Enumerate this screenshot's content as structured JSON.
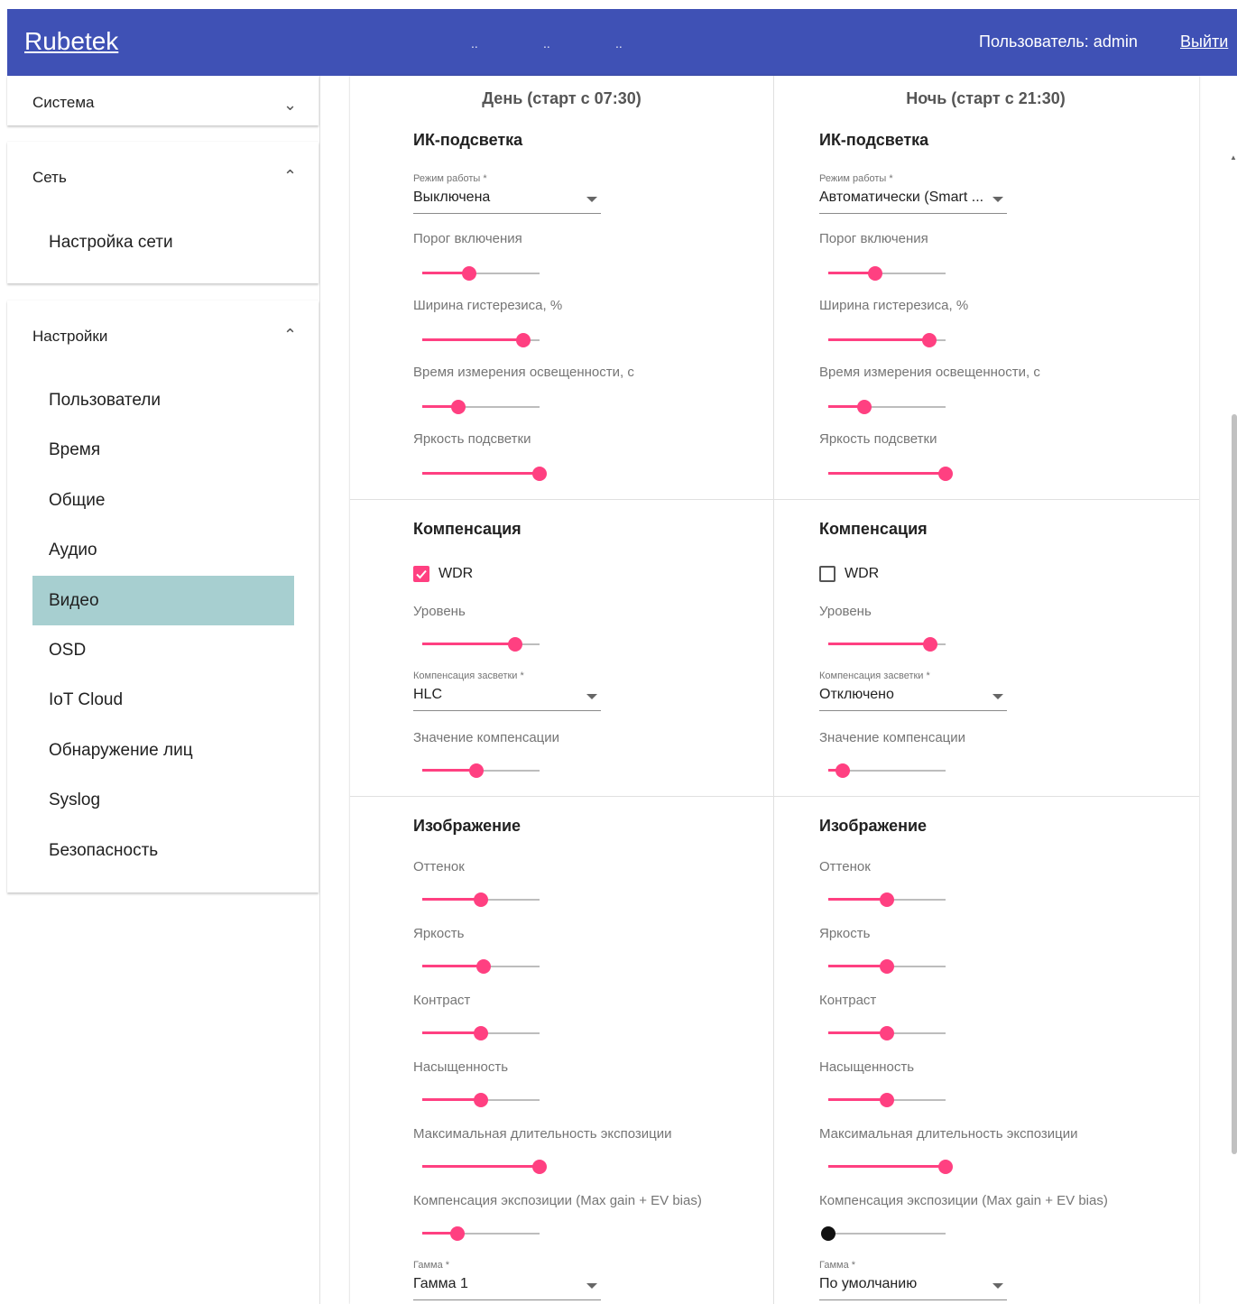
{
  "header": {
    "logo": "Rubetek",
    "dots": [
      "..",
      "..",
      ".."
    ],
    "user": "Пользователь: admin",
    "logout": "Выйти",
    "color": "#3f51b5"
  },
  "sidebar": {
    "system": {
      "label": "Система",
      "icon": "chevron-down-icon"
    },
    "network": {
      "label": "Сеть",
      "icon": "chevron-up-icon",
      "items": [
        "Настройка сети"
      ]
    },
    "settings": {
      "label": "Настройки",
      "icon": "chevron-up-icon",
      "items": [
        "Пользователи",
        "Время",
        "Общие",
        "Аудио",
        "Видео",
        "OSD",
        "IoT Cloud",
        "Обнаружение лиц",
        "Syslog",
        "Безопасность"
      ],
      "active": "Видео",
      "active_color": "#a7cfd0"
    }
  },
  "columns": [
    {
      "heading": "День (старт с 07:30)",
      "ir": {
        "title": "ИК-подсветка",
        "mode_label": "Режим работы *",
        "mode_value": "Выключена",
        "sliders": [
          {
            "label": "Порог включения",
            "value": 0.4
          },
          {
            "label": "Ширина гистерезиса, %",
            "value": 0.86
          },
          {
            "label": "Время измерения освещенности, с",
            "value": 0.31
          },
          {
            "label": "Яркость подсветки",
            "value": 1.0
          }
        ]
      },
      "comp": {
        "title": "Компенсация",
        "wdr_label": "WDR",
        "wdr_checked": true,
        "level": {
          "label": "Уровень",
          "value": 0.79
        },
        "backlight_label": "Компенсация засветки *",
        "backlight_value": "HLC",
        "value_slider": {
          "label": "Значение компенсации",
          "value": 0.46
        }
      },
      "image": {
        "title": "Изображение",
        "sliders": [
          {
            "label": "Оттенок",
            "value": 0.5
          },
          {
            "label": "Яркость",
            "value": 0.52
          },
          {
            "label": "Контраст",
            "value": 0.5
          },
          {
            "label": "Насыщенность",
            "value": 0.5
          },
          {
            "label": "Максимальная длительность экспозиции",
            "value": 1.0
          },
          {
            "label": "Компенсация экспозиции (Max gain + EV bias)",
            "value": 0.3
          }
        ],
        "gamma_label": "Гамма *",
        "gamma_value": "Гамма 1"
      }
    },
    {
      "heading": "Ночь (старт с 21:30)",
      "ir": {
        "title": "ИК-подсветка",
        "mode_label": "Режим работы *",
        "mode_value": "Автоматически (Smart ...",
        "sliders": [
          {
            "label": "Порог включения",
            "value": 0.4
          },
          {
            "label": "Ширина гистерезиса, %",
            "value": 0.86
          },
          {
            "label": "Время измерения освещенности, с",
            "value": 0.31
          },
          {
            "label": "Яркость подсветки",
            "value": 1.0
          }
        ]
      },
      "comp": {
        "title": "Компенсация",
        "wdr_label": "WDR",
        "wdr_checked": false,
        "level": {
          "label": "Уровень",
          "value": 0.87
        },
        "backlight_label": "Компенсация засветки *",
        "backlight_value": "Отключено",
        "value_slider": {
          "label": "Значение компенсации",
          "value": 0.12
        }
      },
      "image": {
        "title": "Изображение",
        "sliders": [
          {
            "label": "Оттенок",
            "value": 0.5
          },
          {
            "label": "Яркость",
            "value": 0.5
          },
          {
            "label": "Контраст",
            "value": 0.5
          },
          {
            "label": "Насыщенность",
            "value": 0.5
          },
          {
            "label": "Максимальная длительность экспозиции",
            "value": 1.0
          },
          {
            "label": "Компенсация экспозиции (Max gain + EV bias)",
            "value": 0.0
          }
        ],
        "gamma_label": "Гамма *",
        "gamma_value": "По умолчанию"
      }
    }
  ],
  "accent_color": "#ff4081"
}
